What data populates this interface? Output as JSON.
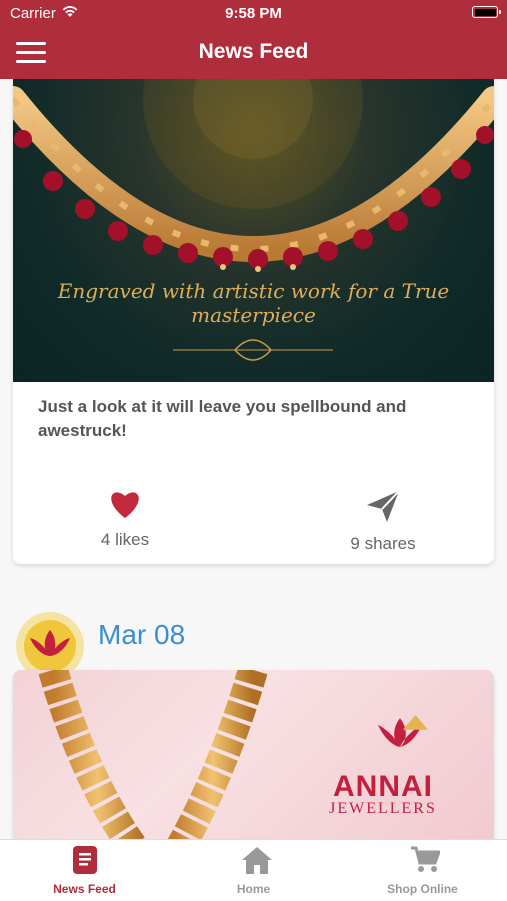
{
  "status_bar": {
    "carrier": "Carrier",
    "time": "9:58 PM"
  },
  "header": {
    "title": "News Feed",
    "menu_icon": "hamburger-menu-icon"
  },
  "feed": {
    "post1": {
      "image_text": "Engraved with artistic work for a True masterpiece",
      "caption": "Just a look at it will leave you spellbound and awestruck!",
      "likes": "4 likes",
      "shares": "9 shares"
    },
    "post2": {
      "date": "Mar 08",
      "brand_name": "ANNAI",
      "brand_sub": "JEWELLERS"
    }
  },
  "tabs": [
    {
      "label": "News Feed",
      "icon": "news-icon",
      "active": true
    },
    {
      "label": "Home",
      "icon": "home-icon",
      "active": false
    },
    {
      "label": "Shop Online",
      "icon": "cart-icon",
      "active": false
    }
  ],
  "colors": {
    "accent": "#b02e3c",
    "date": "#3a8fcf",
    "heart": "#c22a3c"
  }
}
